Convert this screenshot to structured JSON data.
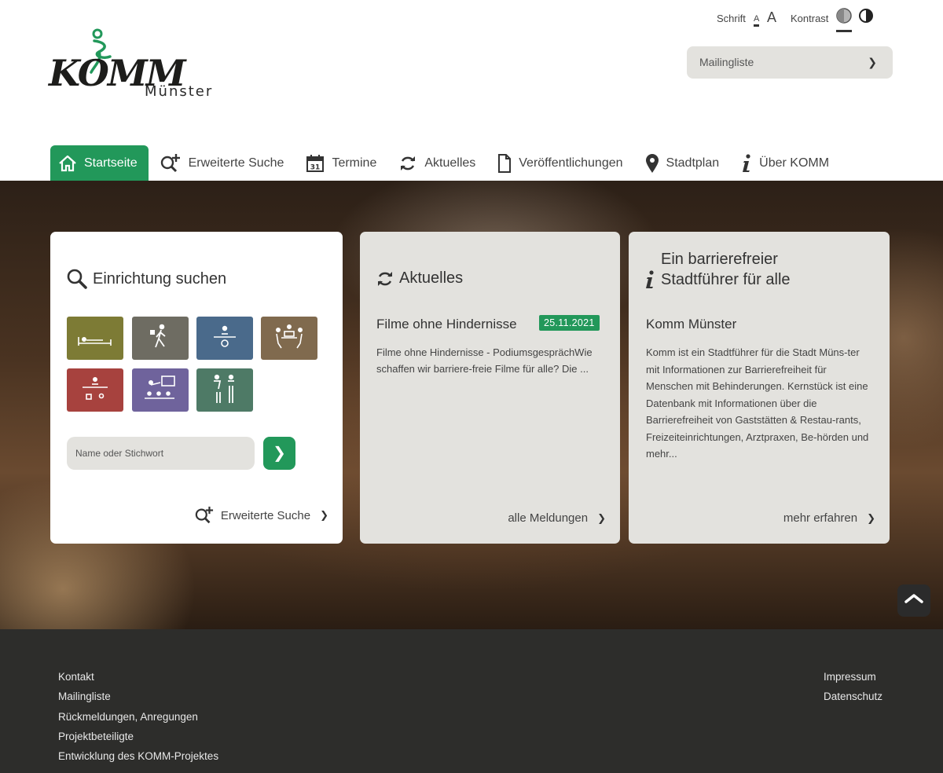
{
  "header": {
    "logo_text": "KOMM",
    "logo_sub": "Münster",
    "font_label": "Schrift",
    "font_small": "A",
    "font_large": "A",
    "contrast_label": "Kontrast",
    "mailing_label": "Mailingliste",
    "mailing_chevron": "❯"
  },
  "nav": {
    "items": [
      {
        "label": "Startseite",
        "icon": "home-icon",
        "active": true
      },
      {
        "label": "Erweiterte Suche",
        "icon": "search-plus-icon"
      },
      {
        "label": "Termine",
        "icon": "calendar-icon"
      },
      {
        "label": "Aktuelles",
        "icon": "refresh-icon"
      },
      {
        "label": "Veröffentlichungen",
        "icon": "document-icon"
      },
      {
        "label": "Stadtplan",
        "icon": "map-pin-icon"
      },
      {
        "label": "Über KOMM",
        "icon": "info-icon"
      }
    ]
  },
  "search_card": {
    "title": "Einrichtung suchen",
    "categories": [
      {
        "name": "Unterkunft",
        "color": "#7d7b35"
      },
      {
        "name": "Freizeit",
        "color": "#6e6c62"
      },
      {
        "name": "Behörde",
        "color": "#4a6a8b"
      },
      {
        "name": "Gastronomie",
        "color": "#806a4e"
      },
      {
        "name": "Gesundheit",
        "color": "#a7423e"
      },
      {
        "name": "Bildung",
        "color": "#6f639c"
      },
      {
        "name": "Toiletten",
        "color": "#4e7a66"
      }
    ],
    "placeholder": "Name oder Stichwort",
    "submit": "❯",
    "link": "Erweiterte Suche",
    "link_chevron": "❯"
  },
  "news_card": {
    "title": "Aktuelles",
    "headline": "Filme ohne Hindernisse",
    "date": "25.11.2021",
    "body": "Filme ohne Hindernisse - PodiumsgesprächWie schaffen wir barriere-freie Filme für alle? Die ...",
    "link": "alle Meldungen",
    "link_chevron": "❯"
  },
  "info_card": {
    "title_line1": "Ein barrierefreier",
    "title_line2": "Stadtführer für alle",
    "headline": "Komm Münster",
    "body": "Komm ist ein Stadtführer für die Stadt Müns-ter mit Informationen zur Barrierefreiheit für Menschen mit Behinderungen. Kernstück ist eine Datenbank mit Informationen über die Barrierefreiheit von Gaststätten & Restau-rants, Freizeiteinrichtungen, Arztpraxen, Be-hörden und mehr...",
    "link": "mehr erfahren",
    "link_chevron": "❯"
  },
  "scroll_top": "︿",
  "footer": {
    "left": [
      "Kontakt",
      "Mailingliste",
      "Rückmeldungen, Anregungen",
      "Projektbeteiligte",
      "Entwicklung des KOMM-Projektes"
    ],
    "right": [
      "Impressum",
      "Datenschutz"
    ]
  },
  "colors": {
    "accent": "#22985a",
    "card_gray": "#e3e2de",
    "footer": "#2d2d2b"
  }
}
